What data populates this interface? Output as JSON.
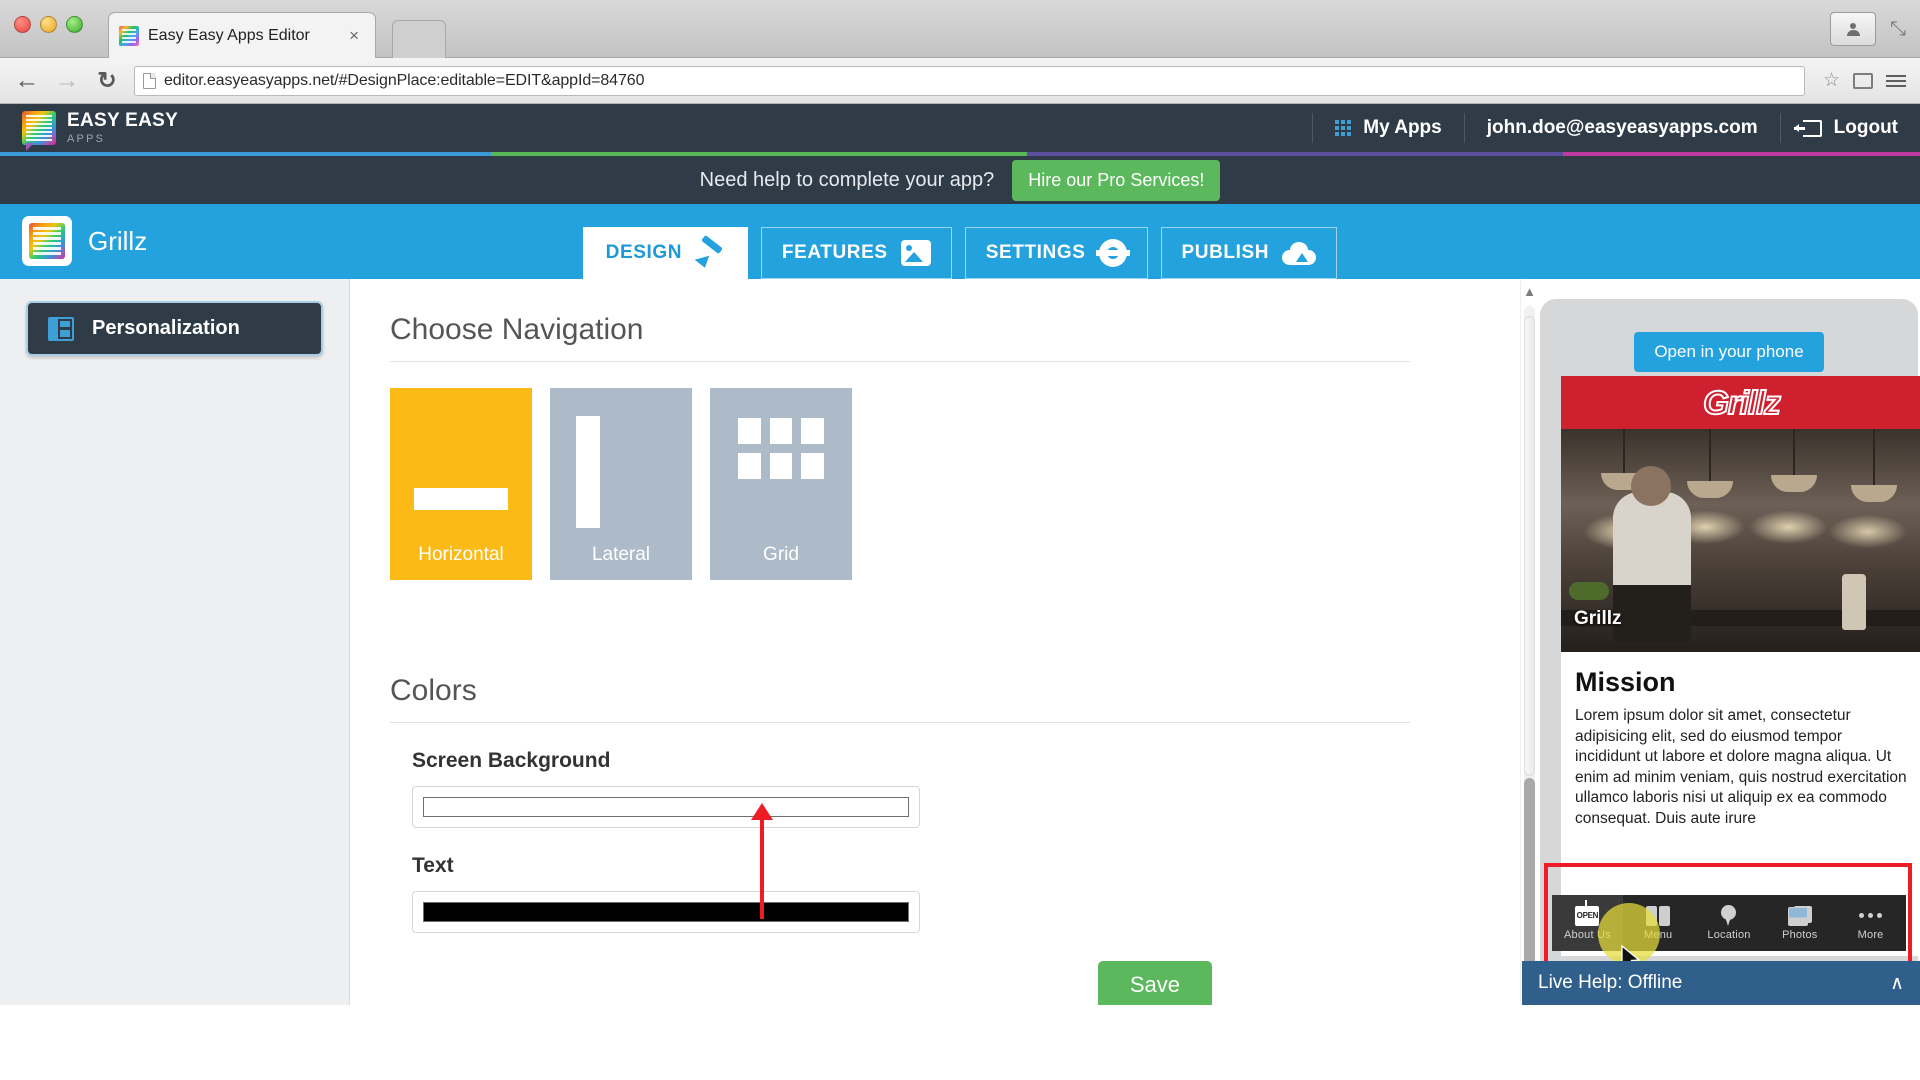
{
  "browser": {
    "tab_title": "Easy Easy Apps Editor",
    "tab_close": "×",
    "url": "editor.easyeasyapps.net/#DesignPlace:editable=EDIT&appId=84760",
    "back_icon": "←",
    "forward_icon": "→",
    "reload_icon": "↻",
    "star_icon": "☆",
    "expand_icon": "⤡"
  },
  "topbar": {
    "brand_name": "EASY EASY",
    "brand_sub": "APPS",
    "my_apps": "My Apps",
    "user_email": "john.doe@easyeasyapps.com",
    "logout": "Logout",
    "stripe_colors": [
      "#3b9ad6",
      "#56b956",
      "#5b4e9e",
      "#c0399f"
    ]
  },
  "promo": {
    "text": "Need help to complete your app?",
    "button": "Hire our Pro Services!"
  },
  "app_nav": {
    "app_name": "Grillz",
    "tabs": [
      {
        "label": "DESIGN",
        "icon": "brush-icon",
        "active": true
      },
      {
        "label": "FEATURES",
        "icon": "tag-icon",
        "active": false
      },
      {
        "label": "SETTINGS",
        "icon": "gear-icon",
        "active": false
      },
      {
        "label": "PUBLISH",
        "icon": "cloud-upload-icon",
        "active": false
      }
    ]
  },
  "sidebar": {
    "items": [
      {
        "label": "Personalization",
        "icon": "layout-icon",
        "active": true
      }
    ]
  },
  "main": {
    "navigation_section": {
      "title": "Choose Navigation",
      "options": [
        {
          "label": "Horizontal",
          "selected": true,
          "color": "#fbba16"
        },
        {
          "label": "Lateral",
          "selected": false,
          "color": "#adbac8"
        },
        {
          "label": "Grid",
          "selected": false,
          "color": "#adbac8"
        }
      ]
    },
    "colors_section": {
      "title": "Colors",
      "fields": [
        {
          "label": "Screen Background",
          "value": "#ffffff"
        },
        {
          "label": "Text",
          "value": "#000000"
        }
      ],
      "save_label": "Save"
    }
  },
  "preview": {
    "open_in_phone": "Open in your phone",
    "app_banner": "Grillz",
    "photo_caption": "Grillz",
    "content_title": "Mission",
    "content_body": "Lorem ipsum dolor sit amet, consectetur adipisicing elit, sed do eiusmod tempor incididunt ut labore et dolore magna aliqua. Ut enim ad minim veniam, quis nostrud exercitation ullamco laboris nisi ut aliquip ex ea commodo consequat. Duis aute irure",
    "nav_items": [
      {
        "label": "About Us",
        "icon": "open-sign-icon",
        "active": true
      },
      {
        "label": "Menu",
        "icon": "book-icon",
        "active": false
      },
      {
        "label": "Location",
        "icon": "map-pin-icon",
        "active": false
      },
      {
        "label": "Photos",
        "icon": "photos-icon",
        "active": false
      },
      {
        "label": "More",
        "icon": "ellipsis-icon",
        "active": false
      }
    ]
  },
  "live_help": {
    "label": "Live Help: Offline",
    "chevron": "∧"
  }
}
